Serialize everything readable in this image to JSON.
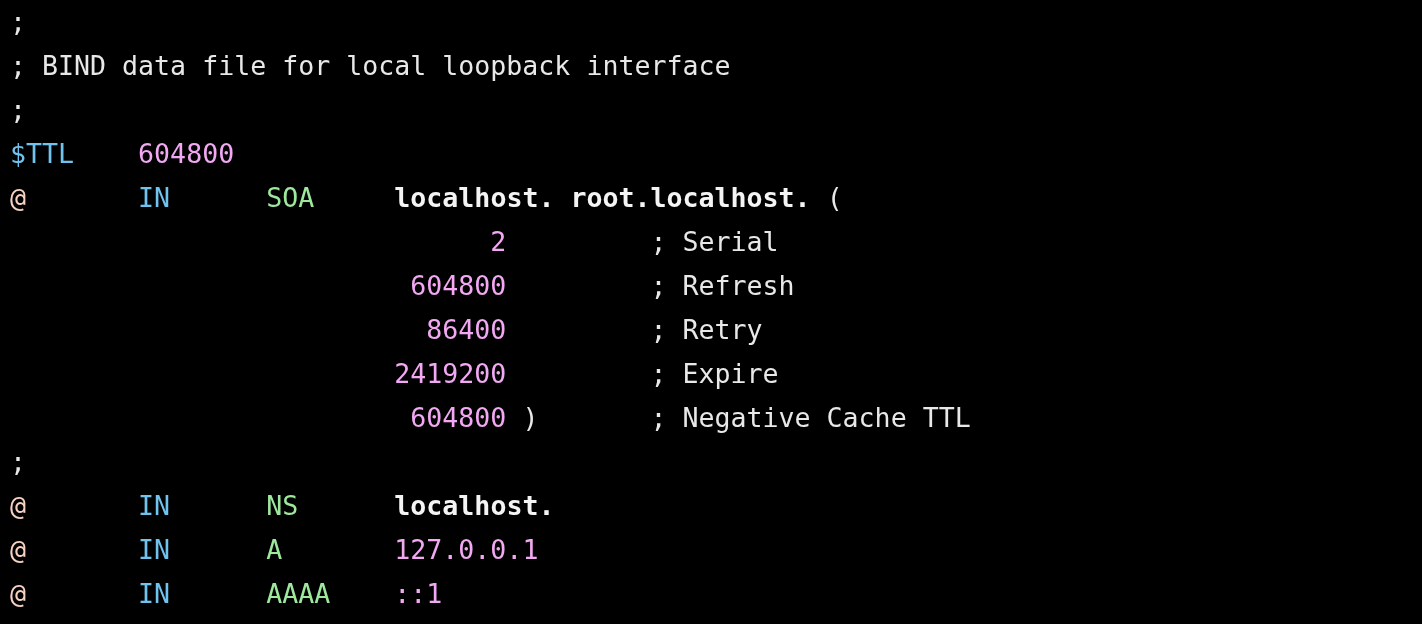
{
  "lines": [
    {
      "kind": "comment",
      "text": ";"
    },
    {
      "kind": "comment",
      "text": "; BIND data file for local loopback interface"
    },
    {
      "kind": "comment",
      "text": ";"
    },
    {
      "kind": "directive",
      "variable": "$TTL",
      "value": "604800"
    },
    {
      "kind": "record",
      "origin": "@",
      "class": "IN",
      "type": "SOA",
      "data": [
        {
          "kind": "name",
          "text": "localhost."
        },
        {
          "kind": "name",
          "text": "root.localhost."
        },
        {
          "kind": "punct",
          "text": "("
        }
      ]
    },
    {
      "kind": "soa_value",
      "value": "2",
      "comment": "; Serial"
    },
    {
      "kind": "soa_value",
      "value": "604800",
      "comment": "; Refresh"
    },
    {
      "kind": "soa_value",
      "value": "86400",
      "comment": "; Retry"
    },
    {
      "kind": "soa_value",
      "value": "2419200",
      "comment": "; Expire"
    },
    {
      "kind": "soa_value",
      "value": "604800",
      "close": ")",
      "comment": "; Negative Cache TTL"
    },
    {
      "kind": "comment",
      "text": ";"
    },
    {
      "kind": "record",
      "origin": "@",
      "class": "IN",
      "type": "NS",
      "data": [
        {
          "kind": "name",
          "text": "localhost."
        }
      ]
    },
    {
      "kind": "record",
      "origin": "@",
      "class": "IN",
      "type": "A",
      "data": [
        {
          "kind": "number",
          "text": "127.0.0.1"
        }
      ]
    },
    {
      "kind": "record",
      "origin": "@",
      "class": "IN",
      "type": "AAAA",
      "data": [
        {
          "kind": "number",
          "text": "::1"
        }
      ]
    }
  ]
}
